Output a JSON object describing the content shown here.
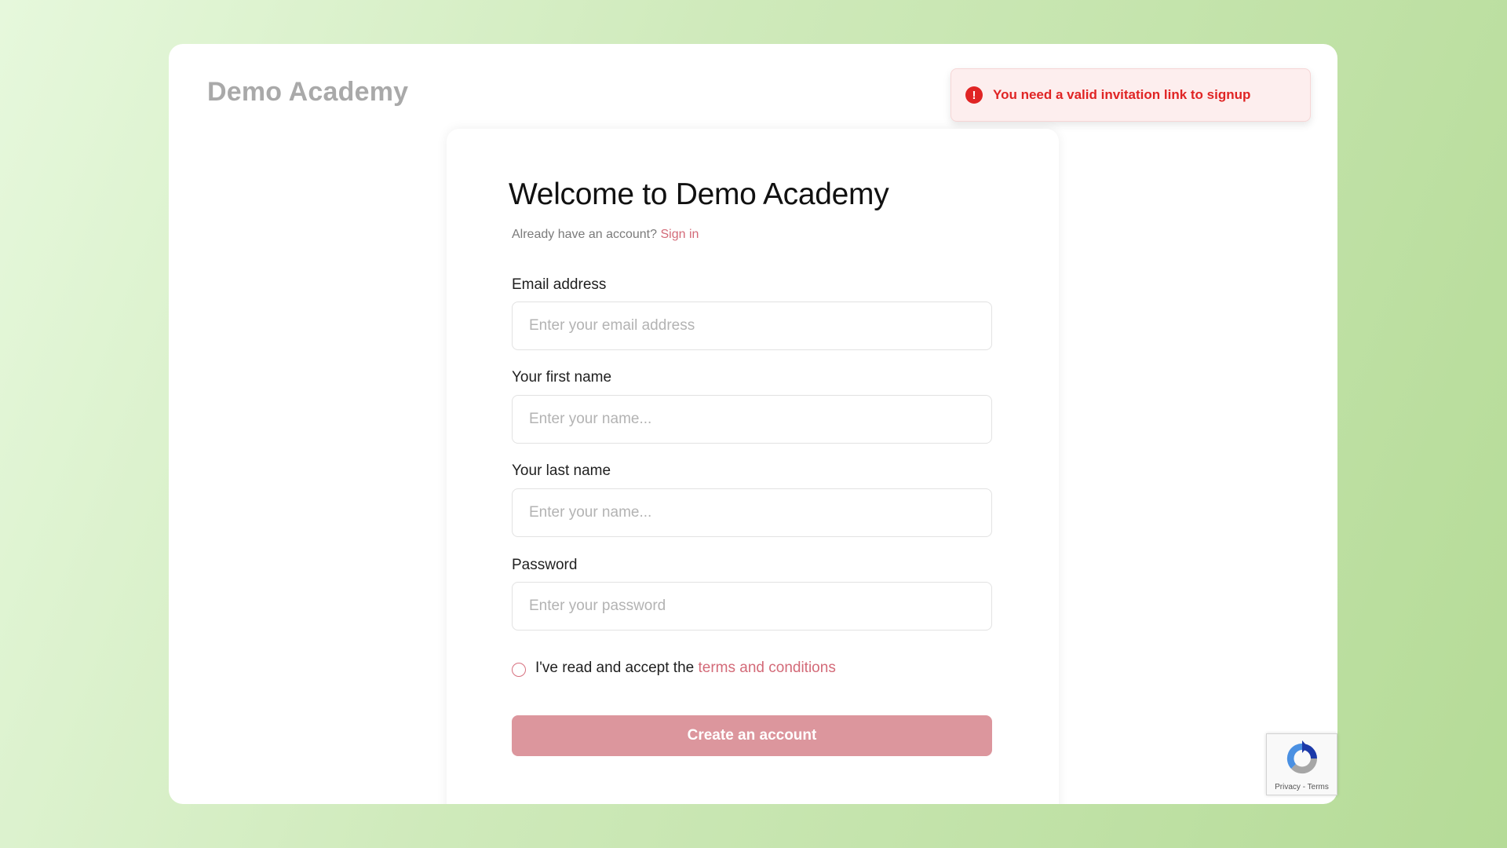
{
  "brand": {
    "name": "Demo Academy"
  },
  "toast": {
    "icon": "alert-circle-icon",
    "icon_glyph": "!",
    "message": "You need a valid invitation link to signup",
    "color": "#e02424"
  },
  "form": {
    "title": "Welcome to Demo Academy",
    "subtitle_text": "Already have an account?",
    "signin_link": "Sign in",
    "fields": [
      {
        "label": "Email address",
        "placeholder": "Enter your email address",
        "value": ""
      },
      {
        "label": "Your first name",
        "placeholder": "Enter your name...",
        "value": ""
      },
      {
        "label": "Your last name",
        "placeholder": "Enter your name...",
        "value": ""
      },
      {
        "label": "Password",
        "placeholder": "Enter your password",
        "value": ""
      }
    ],
    "terms_prefix": "I've read and accept the",
    "terms_link": "terms and conditions",
    "terms_checked": false,
    "submit_label": "Create an account",
    "accent_color": "#d36a78",
    "button_color": "#dc969d"
  },
  "recaptcha": {
    "icon": "recaptcha-icon",
    "privacy": "Privacy",
    "separator": "-",
    "terms": "Terms"
  }
}
